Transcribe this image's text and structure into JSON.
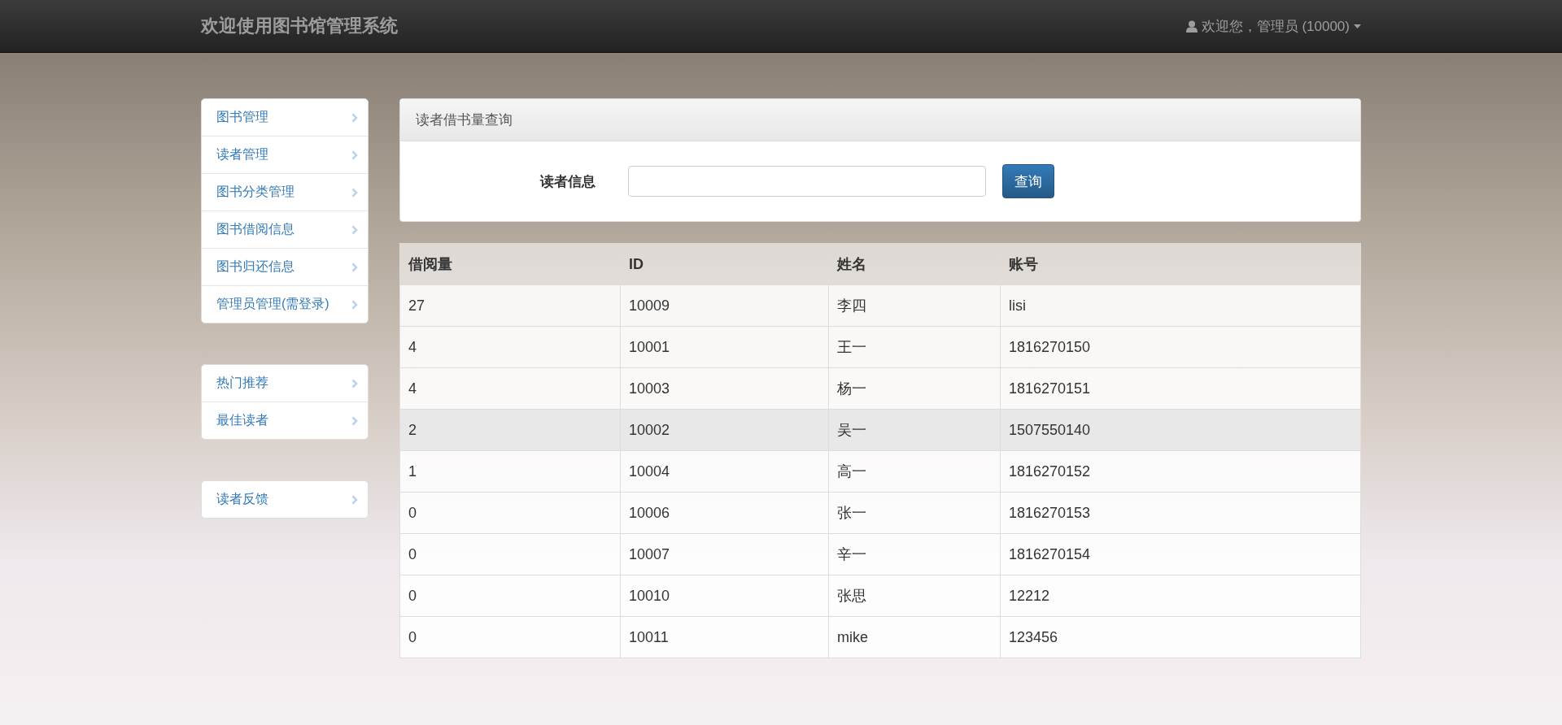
{
  "navbar": {
    "brand": "欢迎使用图书馆管理系统",
    "user_menu": "欢迎您，管理员 (10000)"
  },
  "sidebar": {
    "groups": [
      {
        "items": [
          {
            "label": "图书管理"
          },
          {
            "label": "读者管理"
          },
          {
            "label": "图书分类管理"
          },
          {
            "label": "图书借阅信息"
          },
          {
            "label": "图书归还信息"
          },
          {
            "label": "管理员管理(需登录)"
          }
        ]
      },
      {
        "items": [
          {
            "label": "热门推荐"
          },
          {
            "label": "最佳读者"
          }
        ]
      },
      {
        "items": [
          {
            "label": "读者反馈"
          }
        ]
      }
    ]
  },
  "query_panel": {
    "title": "读者借书量查询",
    "field_label": "读者信息",
    "search_button": "查询"
  },
  "table": {
    "columns": [
      "借阅量",
      "ID",
      "姓名",
      "账号"
    ],
    "rows": [
      {
        "cells": [
          "27",
          "10009",
          "李四",
          "lisi"
        ],
        "selected": false
      },
      {
        "cells": [
          "4",
          "10001",
          "王一",
          "1816270150"
        ],
        "selected": false
      },
      {
        "cells": [
          "4",
          "10003",
          "杨一",
          "1816270151"
        ],
        "selected": false
      },
      {
        "cells": [
          "2",
          "10002",
          "吴一",
          "1507550140"
        ],
        "selected": true
      },
      {
        "cells": [
          "1",
          "10004",
          "高一",
          "1816270152"
        ],
        "selected": false
      },
      {
        "cells": [
          "0",
          "10006",
          "张一",
          "1816270153"
        ],
        "selected": false
      },
      {
        "cells": [
          "0",
          "10007",
          "辛一",
          "1816270154"
        ],
        "selected": false
      },
      {
        "cells": [
          "0",
          "10010",
          "张思",
          "12212"
        ],
        "selected": false
      },
      {
        "cells": [
          "0",
          "10011",
          "mike",
          "123456"
        ],
        "selected": false
      }
    ]
  }
}
